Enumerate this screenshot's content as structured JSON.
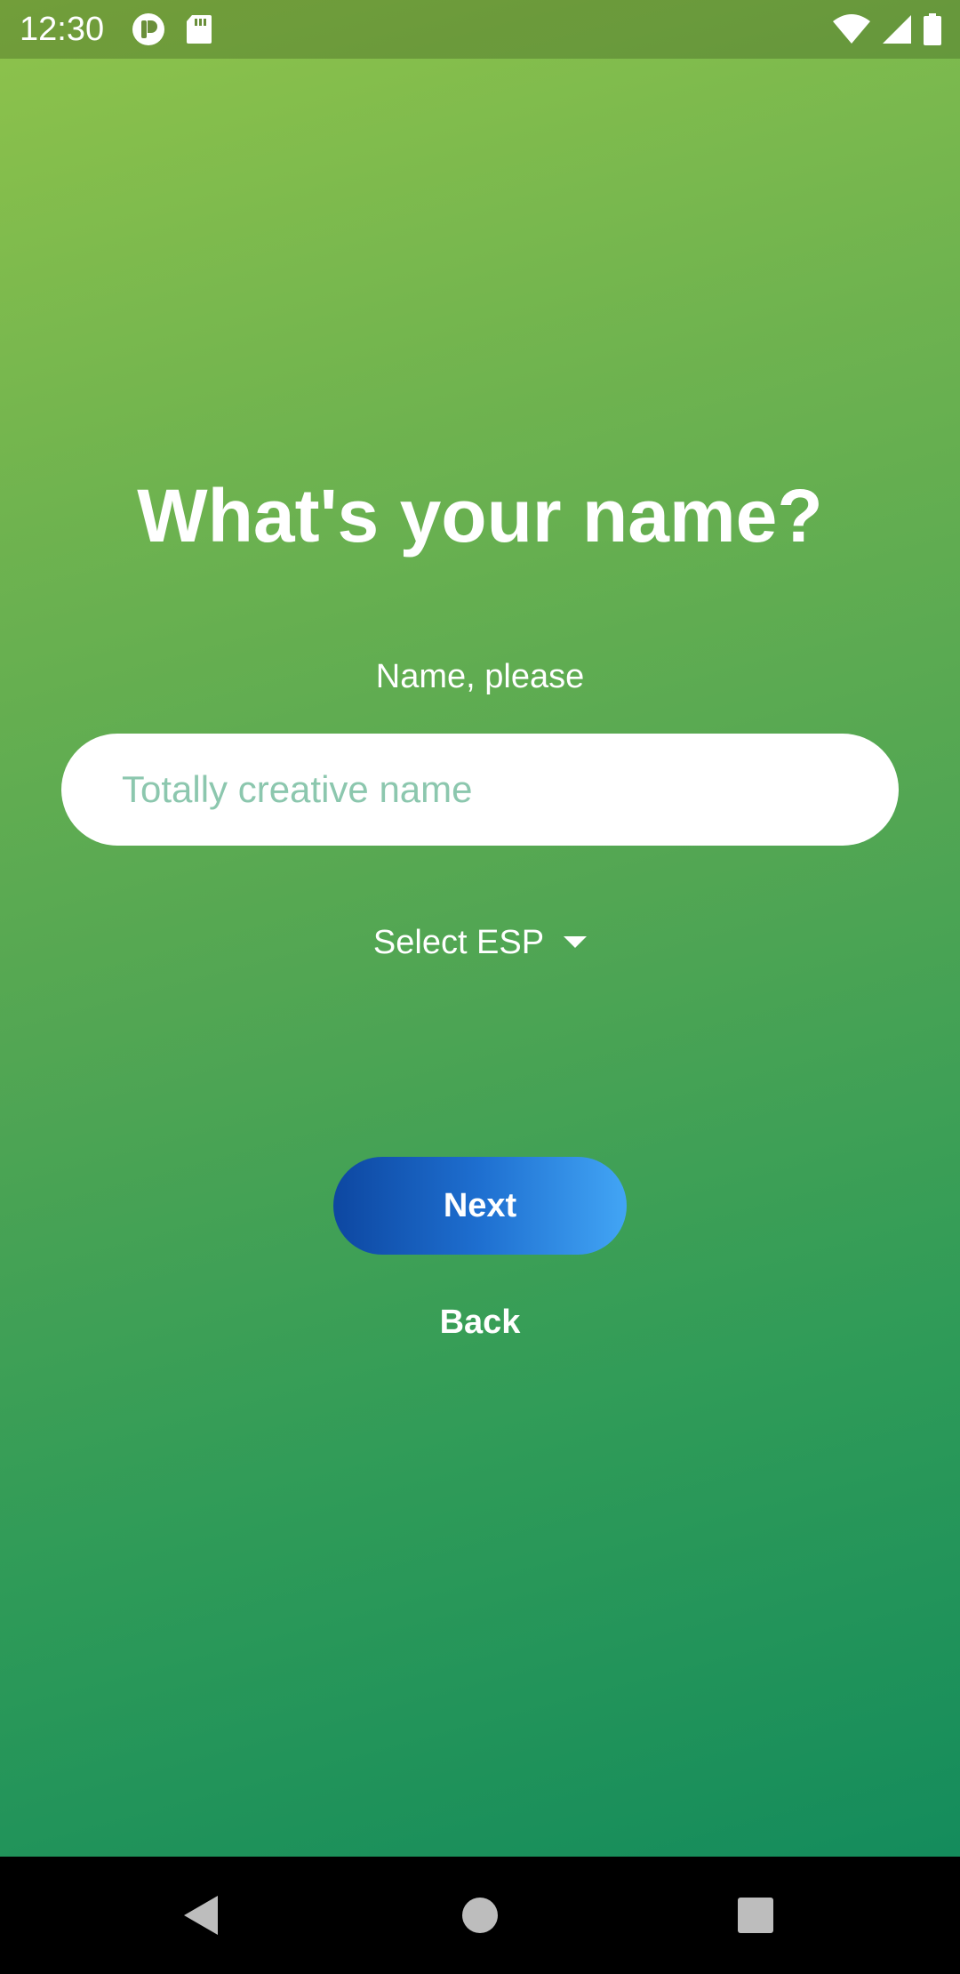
{
  "status_bar": {
    "time": "12:30",
    "left_icons": [
      "notification-app-icon",
      "sd-card-icon"
    ],
    "right_icons": [
      "wifi-icon",
      "cellular-signal-icon",
      "battery-icon"
    ]
  },
  "screen": {
    "title": "What's your name?",
    "name_label": "Name, please",
    "name_input": {
      "value": "",
      "placeholder": "Totally creative name"
    },
    "esp_select": {
      "label": "Select ESP",
      "icon": "dropdown-arrow-icon"
    },
    "next_label": "Next",
    "back_label": "Back"
  },
  "nav_bar": {
    "icons": [
      "back-triangle-icon",
      "home-circle-icon",
      "recents-square-icon"
    ]
  },
  "colors": {
    "gradient_top": "#8fc34b",
    "gradient_bottom": "#148c5c",
    "placeholder": "#8cc7ae",
    "button_start": "#0d47a1",
    "button_end": "#42a5f5"
  }
}
